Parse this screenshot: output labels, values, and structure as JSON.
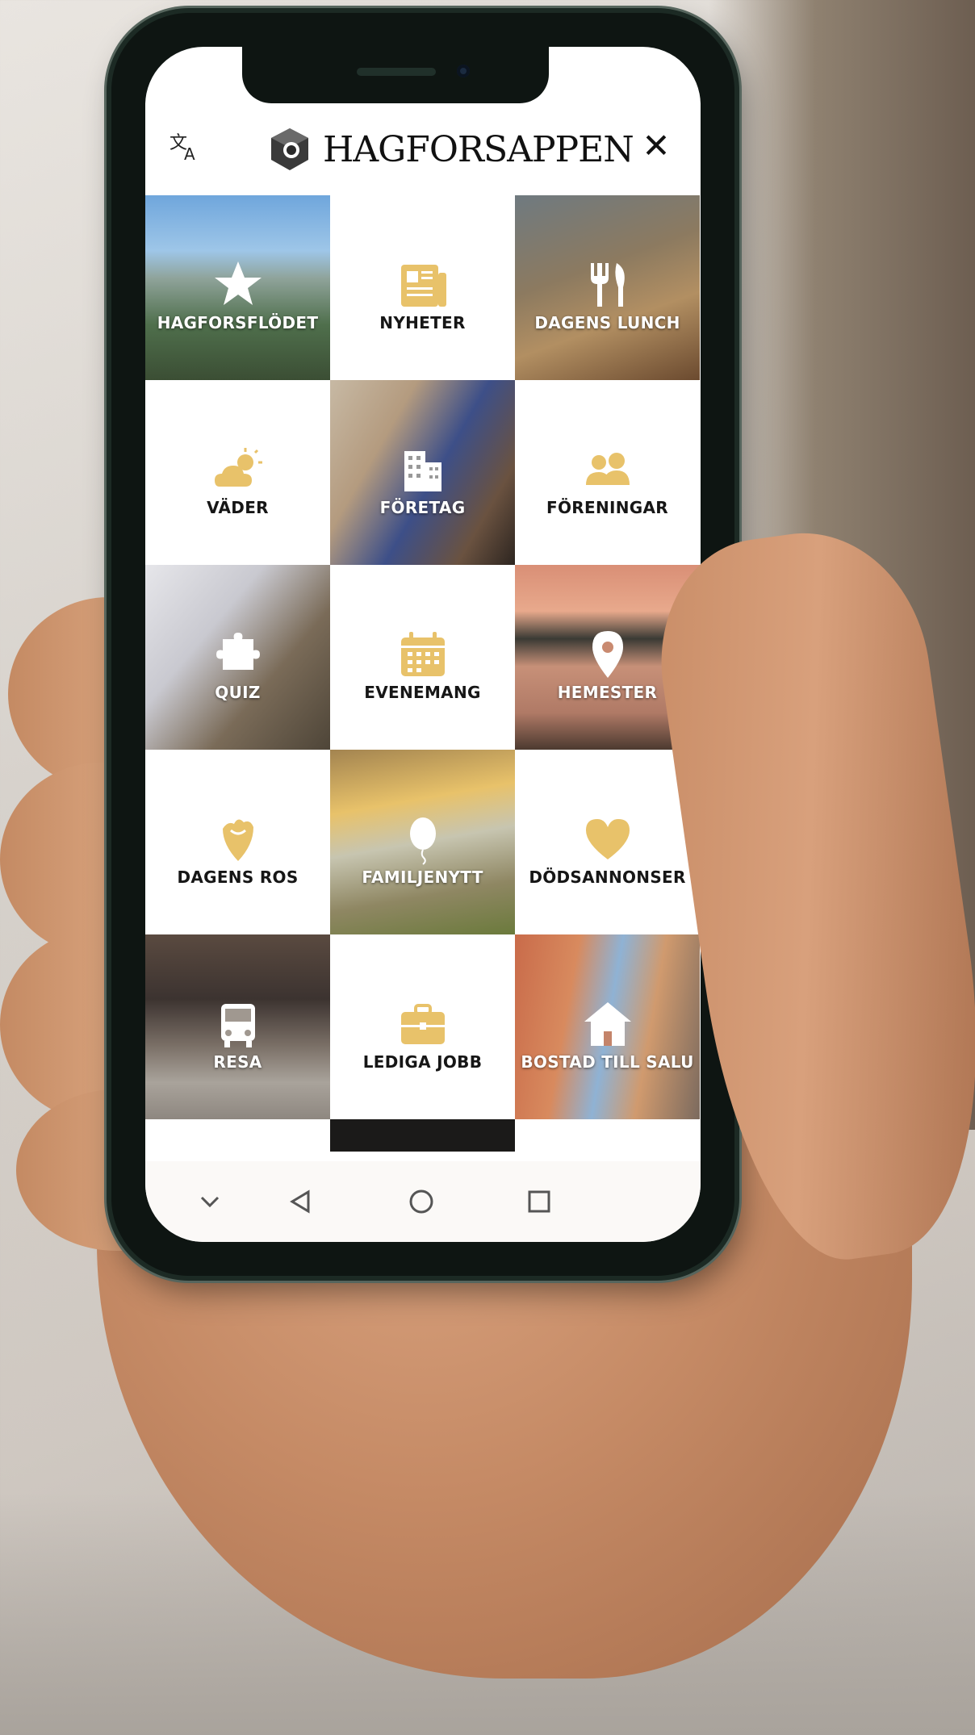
{
  "app": {
    "title": "HAGFORSAPPEN"
  },
  "header": {
    "translate_icon": "translate-icon",
    "close_icon": "close-icon",
    "close_glyph": "✕"
  },
  "tiles": [
    {
      "label": "HAGFORSFLÖDET",
      "icon": "star-icon",
      "kind": "photo"
    },
    {
      "label": "NYHETER",
      "icon": "newspaper-icon",
      "kind": "white"
    },
    {
      "label": "DAGENS LUNCH",
      "icon": "cutlery-icon",
      "kind": "photo"
    },
    {
      "label": "VÄDER",
      "icon": "sun-cloud-icon",
      "kind": "white"
    },
    {
      "label": "FÖRETAG",
      "icon": "buildings-icon",
      "kind": "photo"
    },
    {
      "label": "FÖRENINGAR",
      "icon": "people-icon",
      "kind": "white"
    },
    {
      "label": "QUIZ",
      "icon": "puzzle-icon",
      "kind": "photo"
    },
    {
      "label": "EVENEMANG",
      "icon": "calendar-icon",
      "kind": "white"
    },
    {
      "label": "HEMESTER",
      "icon": "location-pin-icon",
      "kind": "photo"
    },
    {
      "label": "DAGENS ROS",
      "icon": "rose-icon",
      "kind": "white"
    },
    {
      "label": "FAMILJENYTT",
      "icon": "balloon-icon",
      "kind": "photo"
    },
    {
      "label": "DÖDSANNONSER",
      "icon": "heart-icon",
      "kind": "white"
    },
    {
      "label": "RESA",
      "icon": "bus-icon",
      "kind": "photo"
    },
    {
      "label": "LEDIGA JOBB",
      "icon": "briefcase-icon",
      "kind": "white"
    },
    {
      "label": "BOSTAD TILL SALU",
      "icon": "house-icon",
      "kind": "photo"
    }
  ],
  "navbar": {
    "items": [
      "chevron-down-icon",
      "back-triangle-icon",
      "home-circle-icon",
      "recents-square-icon"
    ]
  },
  "colors": {
    "accent": "#e8c26a",
    "tile_white": "#ffffff",
    "label_dark": "#161616"
  }
}
